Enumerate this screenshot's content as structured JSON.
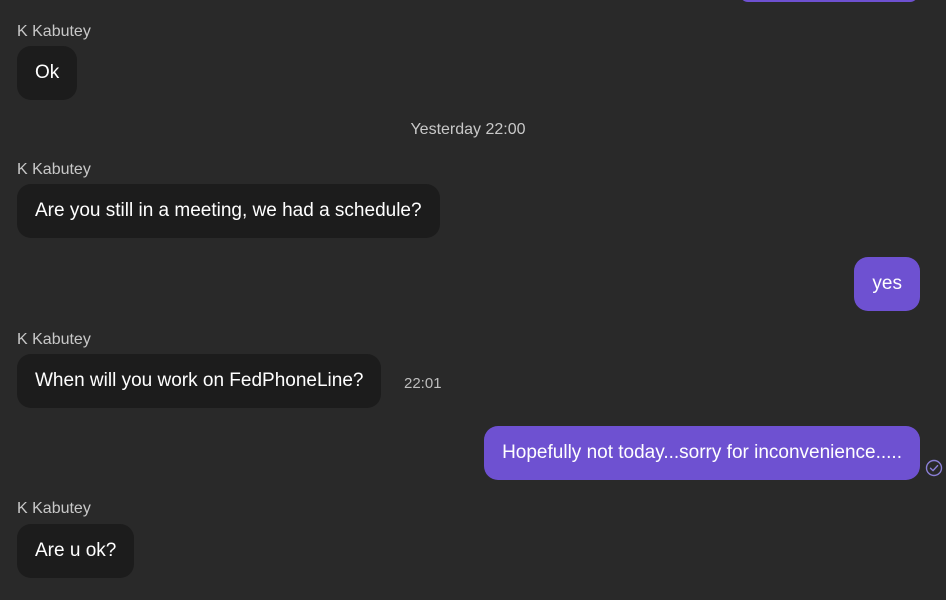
{
  "conversation": {
    "date_separator": "Yesterday 22:00",
    "messages": [
      {
        "sender": "K Kabutey",
        "text": "Ok"
      },
      {
        "sender": "K Kabutey",
        "text": "Are you still in a meeting, we had a schedule?"
      },
      {
        "text": "yes"
      },
      {
        "sender": "K Kabutey",
        "text": "When will you work on FedPhoneLine?",
        "time": "22:01"
      },
      {
        "text": "Hopefully not today...sorry for inconvenience....."
      },
      {
        "sender": "K Kabutey",
        "text": "Are u ok?"
      }
    ]
  },
  "colors": {
    "background": "#292929",
    "incoming_bubble": "#1c1c1c",
    "outgoing_bubble": "#6e51d1",
    "read_receipt": "#8a7fd6"
  },
  "icons": {
    "read_receipt": "check-circle-icon"
  }
}
